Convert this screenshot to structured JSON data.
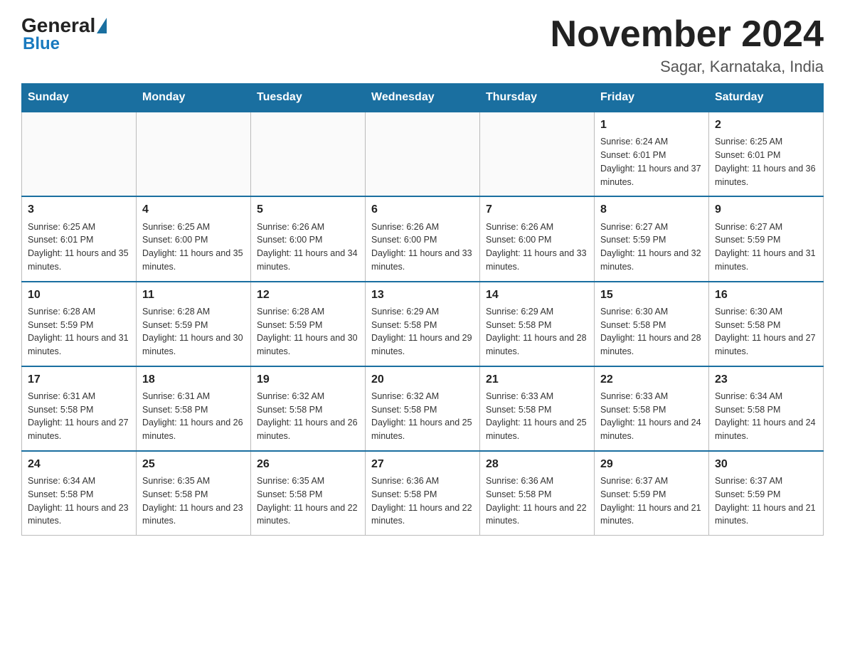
{
  "logo": {
    "general": "General",
    "blue": "Blue"
  },
  "title": "November 2024",
  "location": "Sagar, Karnataka, India",
  "days_of_week": [
    "Sunday",
    "Monday",
    "Tuesday",
    "Wednesday",
    "Thursday",
    "Friday",
    "Saturday"
  ],
  "weeks": [
    [
      {
        "day": "",
        "info": ""
      },
      {
        "day": "",
        "info": ""
      },
      {
        "day": "",
        "info": ""
      },
      {
        "day": "",
        "info": ""
      },
      {
        "day": "",
        "info": ""
      },
      {
        "day": "1",
        "info": "Sunrise: 6:24 AM\nSunset: 6:01 PM\nDaylight: 11 hours and 37 minutes."
      },
      {
        "day": "2",
        "info": "Sunrise: 6:25 AM\nSunset: 6:01 PM\nDaylight: 11 hours and 36 minutes."
      }
    ],
    [
      {
        "day": "3",
        "info": "Sunrise: 6:25 AM\nSunset: 6:01 PM\nDaylight: 11 hours and 35 minutes."
      },
      {
        "day": "4",
        "info": "Sunrise: 6:25 AM\nSunset: 6:00 PM\nDaylight: 11 hours and 35 minutes."
      },
      {
        "day": "5",
        "info": "Sunrise: 6:26 AM\nSunset: 6:00 PM\nDaylight: 11 hours and 34 minutes."
      },
      {
        "day": "6",
        "info": "Sunrise: 6:26 AM\nSunset: 6:00 PM\nDaylight: 11 hours and 33 minutes."
      },
      {
        "day": "7",
        "info": "Sunrise: 6:26 AM\nSunset: 6:00 PM\nDaylight: 11 hours and 33 minutes."
      },
      {
        "day": "8",
        "info": "Sunrise: 6:27 AM\nSunset: 5:59 PM\nDaylight: 11 hours and 32 minutes."
      },
      {
        "day": "9",
        "info": "Sunrise: 6:27 AM\nSunset: 5:59 PM\nDaylight: 11 hours and 31 minutes."
      }
    ],
    [
      {
        "day": "10",
        "info": "Sunrise: 6:28 AM\nSunset: 5:59 PM\nDaylight: 11 hours and 31 minutes."
      },
      {
        "day": "11",
        "info": "Sunrise: 6:28 AM\nSunset: 5:59 PM\nDaylight: 11 hours and 30 minutes."
      },
      {
        "day": "12",
        "info": "Sunrise: 6:28 AM\nSunset: 5:59 PM\nDaylight: 11 hours and 30 minutes."
      },
      {
        "day": "13",
        "info": "Sunrise: 6:29 AM\nSunset: 5:58 PM\nDaylight: 11 hours and 29 minutes."
      },
      {
        "day": "14",
        "info": "Sunrise: 6:29 AM\nSunset: 5:58 PM\nDaylight: 11 hours and 28 minutes."
      },
      {
        "day": "15",
        "info": "Sunrise: 6:30 AM\nSunset: 5:58 PM\nDaylight: 11 hours and 28 minutes."
      },
      {
        "day": "16",
        "info": "Sunrise: 6:30 AM\nSunset: 5:58 PM\nDaylight: 11 hours and 27 minutes."
      }
    ],
    [
      {
        "day": "17",
        "info": "Sunrise: 6:31 AM\nSunset: 5:58 PM\nDaylight: 11 hours and 27 minutes."
      },
      {
        "day": "18",
        "info": "Sunrise: 6:31 AM\nSunset: 5:58 PM\nDaylight: 11 hours and 26 minutes."
      },
      {
        "day": "19",
        "info": "Sunrise: 6:32 AM\nSunset: 5:58 PM\nDaylight: 11 hours and 26 minutes."
      },
      {
        "day": "20",
        "info": "Sunrise: 6:32 AM\nSunset: 5:58 PM\nDaylight: 11 hours and 25 minutes."
      },
      {
        "day": "21",
        "info": "Sunrise: 6:33 AM\nSunset: 5:58 PM\nDaylight: 11 hours and 25 minutes."
      },
      {
        "day": "22",
        "info": "Sunrise: 6:33 AM\nSunset: 5:58 PM\nDaylight: 11 hours and 24 minutes."
      },
      {
        "day": "23",
        "info": "Sunrise: 6:34 AM\nSunset: 5:58 PM\nDaylight: 11 hours and 24 minutes."
      }
    ],
    [
      {
        "day": "24",
        "info": "Sunrise: 6:34 AM\nSunset: 5:58 PM\nDaylight: 11 hours and 23 minutes."
      },
      {
        "day": "25",
        "info": "Sunrise: 6:35 AM\nSunset: 5:58 PM\nDaylight: 11 hours and 23 minutes."
      },
      {
        "day": "26",
        "info": "Sunrise: 6:35 AM\nSunset: 5:58 PM\nDaylight: 11 hours and 22 minutes."
      },
      {
        "day": "27",
        "info": "Sunrise: 6:36 AM\nSunset: 5:58 PM\nDaylight: 11 hours and 22 minutes."
      },
      {
        "day": "28",
        "info": "Sunrise: 6:36 AM\nSunset: 5:58 PM\nDaylight: 11 hours and 22 minutes."
      },
      {
        "day": "29",
        "info": "Sunrise: 6:37 AM\nSunset: 5:59 PM\nDaylight: 11 hours and 21 minutes."
      },
      {
        "day": "30",
        "info": "Sunrise: 6:37 AM\nSunset: 5:59 PM\nDaylight: 11 hours and 21 minutes."
      }
    ]
  ]
}
